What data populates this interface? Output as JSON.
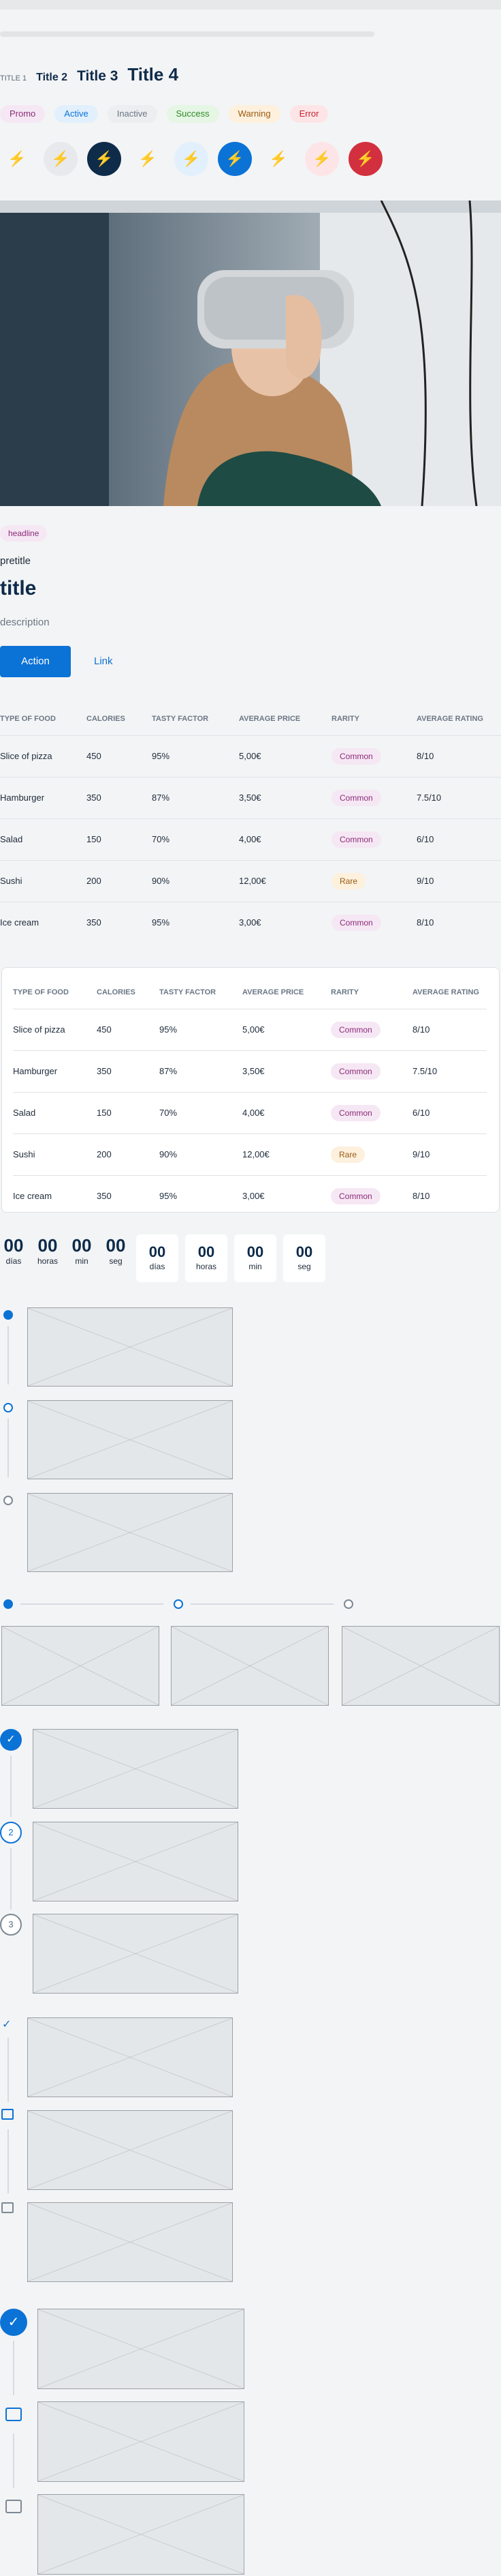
{
  "titles": {
    "t1": "TITLE 1",
    "t2": "Title 2",
    "t3": "Title 3",
    "t4": "Title 4"
  },
  "tags": [
    {
      "label": "Promo",
      "bg": "#f6e7f4",
      "fg": "#8b2c78"
    },
    {
      "label": "Active",
      "bg": "#e1f0fc",
      "fg": "#0b72d6"
    },
    {
      "label": "Inactive",
      "bg": "#eceef0",
      "fg": "#6b7785"
    },
    {
      "label": "Success",
      "bg": "#e5f6e4",
      "fg": "#2f8a2a"
    },
    {
      "label": "Warning",
      "bg": "#fdf0dd",
      "fg": "#9a5a10"
    },
    {
      "label": "Error",
      "bg": "#fde5e7",
      "fg": "#c8202f"
    }
  ],
  "icon_buttons": [
    {
      "icon": "lightning-icon",
      "glyph": "⚡",
      "bg": "#f3f4f5",
      "fg": "#0e2b4a",
      "ring": false
    },
    {
      "icon": "lightning-icon",
      "glyph": "⚡",
      "bg": "#e7e9ec",
      "fg": "#0e2b4a",
      "ring": false
    },
    {
      "icon": "lightning-icon",
      "glyph": "⚡",
      "bg": "#0e2b4a",
      "fg": "#ffffff",
      "ring": false
    },
    {
      "icon": "lightning-icon",
      "glyph": "⚡",
      "bg": "#f3f4f5",
      "fg": "#0b72d6",
      "ring": false
    },
    {
      "icon": "lightning-icon",
      "glyph": "⚡",
      "bg": "#e1f0fc",
      "fg": "#0b72d6",
      "ring": false
    },
    {
      "icon": "lightning-icon",
      "glyph": "⚡",
      "bg": "#0b72d6",
      "fg": "#ffffff",
      "ring": false
    },
    {
      "icon": "lightning-icon",
      "glyph": "⚡",
      "bg": "#f3f4f5",
      "fg": "#d3303f",
      "ring": false
    },
    {
      "icon": "lightning-icon",
      "glyph": "⚡",
      "bg": "#fde5e7",
      "fg": "#d3303f",
      "ring": false
    },
    {
      "icon": "lightning-icon",
      "glyph": "⚡",
      "bg": "#d3303f",
      "fg": "#ffffff",
      "ring": false
    }
  ],
  "card": {
    "badge": "headline",
    "pretitle": "pretitle",
    "title": "title",
    "description": "description",
    "action": "Action",
    "link": "Link"
  },
  "table": {
    "headers": [
      "TYPE OF FOOD",
      "CALORIES",
      "TASTY FACTOR",
      "AVERAGE PRICE",
      "RARITY",
      "AVERAGE RATING"
    ],
    "rows": [
      [
        "Slice of pizza",
        "450",
        "95%",
        "5,00€",
        "Common",
        "8/10"
      ],
      [
        "Hamburger",
        "350",
        "87%",
        "3,50€",
        "Common",
        "7.5/10"
      ],
      [
        "Salad",
        "150",
        "70%",
        "4,00€",
        "Common",
        "6/10"
      ],
      [
        "Sushi",
        "200",
        "90%",
        "12,00€",
        "Rare",
        "9/10"
      ],
      [
        "Ice cream",
        "350",
        "95%",
        "3,00€",
        "Common",
        "8/10"
      ]
    ]
  },
  "countdown": {
    "plain": [
      {
        "n": "00",
        "l": "días"
      },
      {
        "n": "00",
        "l": "horas"
      },
      {
        "n": "00",
        "l": "min"
      },
      {
        "n": "00",
        "l": "seg"
      }
    ],
    "boxed": [
      {
        "n": "00",
        "l": "días"
      },
      {
        "n": "00",
        "l": "horas"
      },
      {
        "n": "00",
        "l": "min"
      },
      {
        "n": "00",
        "l": "seg"
      }
    ]
  },
  "steps": {
    "s2": "2",
    "s3": "3"
  },
  "colors": {
    "accent": "#0b72d6",
    "navy": "#0e2b4a"
  }
}
